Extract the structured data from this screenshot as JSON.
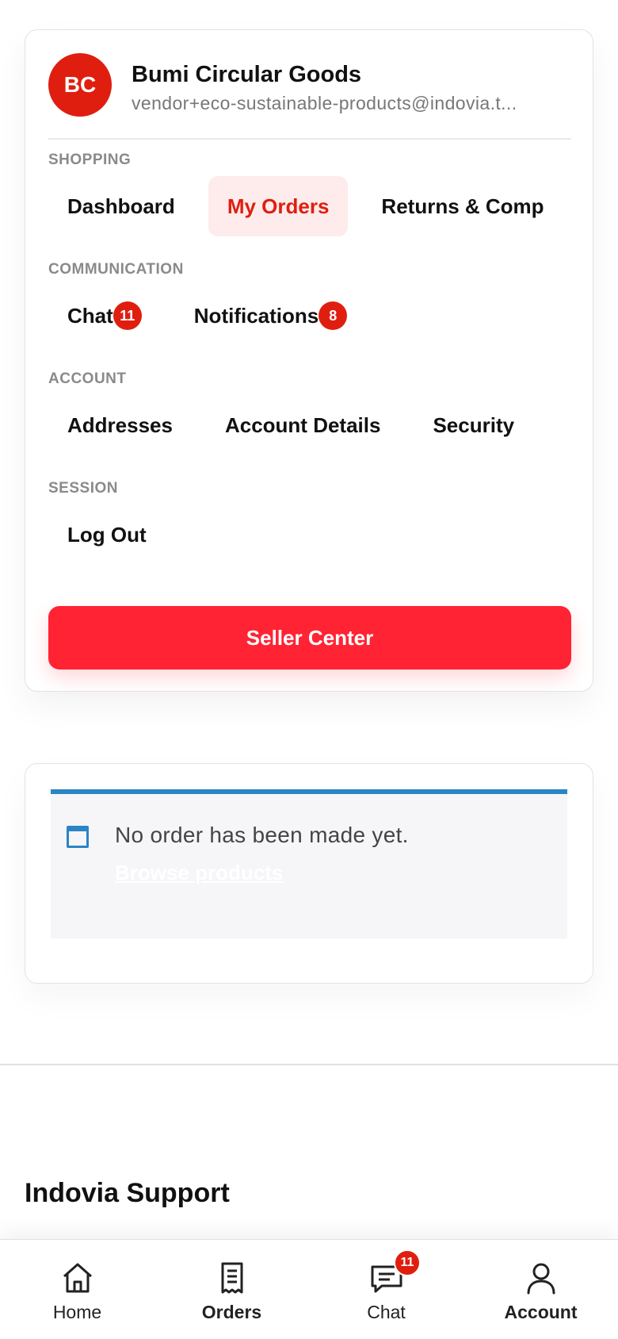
{
  "profile": {
    "initials": "BC",
    "name": "Bumi Circular Goods",
    "email": "vendor+eco-sustainable-products@indovia.t..."
  },
  "sections": {
    "shopping": {
      "label": "SHOPPING",
      "items": [
        "Dashboard",
        "My Orders",
        "Returns & Comp"
      ]
    },
    "communication": {
      "label": "COMMUNICATION",
      "items": [
        {
          "label": "Chat",
          "badge": "11"
        },
        {
          "label": "Notifications",
          "badge": "8"
        }
      ]
    },
    "account": {
      "label": "ACCOUNT",
      "items": [
        "Addresses",
        "Account Details",
        "Security"
      ]
    },
    "session": {
      "label": "SESSION",
      "items": [
        "Log Out"
      ]
    }
  },
  "seller_center_label": "Seller Center",
  "orders": {
    "empty_message": "No order has been made yet.",
    "browse_link": "Browse products"
  },
  "support": {
    "title": "Indovia Support"
  },
  "bottom_nav": {
    "home": "Home",
    "orders": "Orders",
    "chat": "Chat",
    "chat_badge": "11",
    "account": "Account"
  },
  "colors": {
    "accent": "#e01e0f",
    "button": "#ff2333",
    "active_bg": "#fdeceb",
    "info_blue": "#2a85c4"
  }
}
